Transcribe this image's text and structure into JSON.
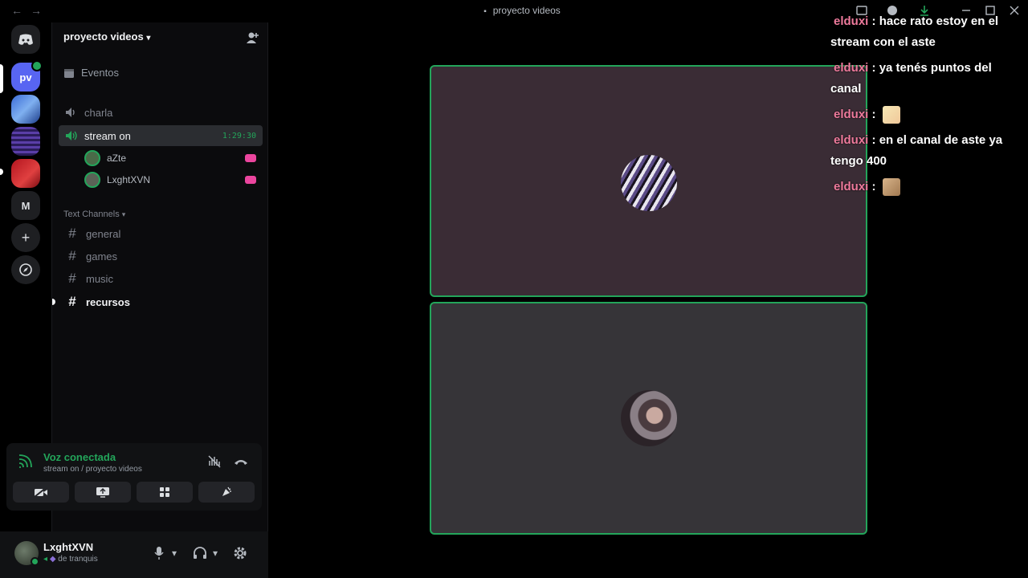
{
  "window": {
    "title": "proyecto videos",
    "back_arrow": "←",
    "forward_arrow": "→"
  },
  "rail": {
    "home_icon": "discord-icon",
    "server_pv_label": "pv",
    "server_m_label": "M",
    "add_label": "+",
    "explore_icon": "compass-icon"
  },
  "sidebar": {
    "server_name": "proyecto videos",
    "events_label": "Eventos",
    "voice_channels": [
      {
        "name": "charla"
      },
      {
        "name": "stream on",
        "timer": "1:29:30"
      }
    ],
    "voice_users": [
      {
        "name": "aZte"
      },
      {
        "name": "LxghtXVN"
      }
    ],
    "category_label": "Text Channels",
    "text_channels": [
      {
        "name": "general"
      },
      {
        "name": "games"
      },
      {
        "name": "music"
      },
      {
        "name": "recursos"
      }
    ]
  },
  "voice_panel": {
    "status": "Voz conectada",
    "location": "stream on / proyecto videos"
  },
  "user_panel": {
    "name": "LxghtXVN",
    "status_text": "de tranquis"
  },
  "chat": {
    "messages": [
      {
        "user": "elduxi",
        "text": "hace rato estoy en el stream con el aste",
        "emote": ""
      },
      {
        "user": "elduxi",
        "text": "ya tenés puntos del canal",
        "emote": ""
      },
      {
        "user": "elduxi",
        "text": "",
        "emote": "emote-a"
      },
      {
        "user": "elduxi",
        "text": "en el canal de aste ya tengo 400",
        "emote": ""
      },
      {
        "user": "elduxi",
        "text": "",
        "emote": "emote-b"
      }
    ]
  },
  "colors": {
    "accent_green": "#23a55a",
    "brand": "#5865f2",
    "chat_user": "#ee7a9c"
  }
}
